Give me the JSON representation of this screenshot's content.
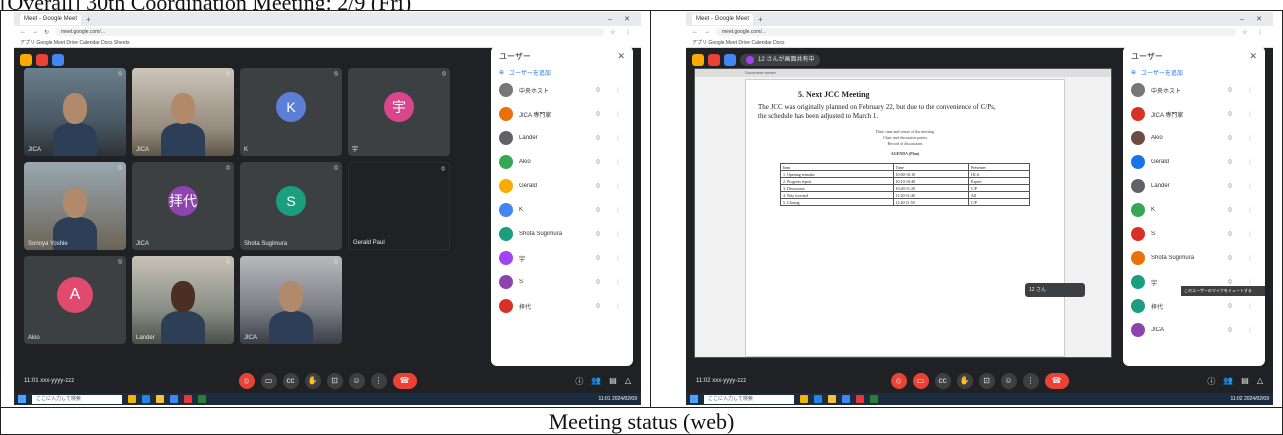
{
  "document": {
    "title": "[Overall] 30th Coordination Meeting: 2/9 (Fri)",
    "caption": "Meeting status (web)"
  },
  "left_screenshot": {
    "browser": {
      "tab_title": "Meet - Google Meet",
      "new_tab": "+",
      "window_controls": "– ✕",
      "url": "meet.google.com/...",
      "address_icons": "☆ ⋮",
      "bookmarks": "アプリ   Google   Meet   Drive   Calendar   Docs   Sheets"
    },
    "meet_icons": [
      "yellow-app-icon",
      "red-app-icon",
      "blue-app-icon"
    ],
    "tiles": [
      {
        "name": "JICA",
        "kind": "video",
        "video": "v1"
      },
      {
        "name": "JICA",
        "kind": "video",
        "video": "v2"
      },
      {
        "name": "K",
        "initial": "K",
        "color": "#5b7fd6"
      },
      {
        "name": "宇",
        "initial": "宇",
        "color": "#d9468c"
      },
      {
        "name": "Sonoya Yoshie",
        "kind": "video",
        "video": "v3"
      },
      {
        "name": "JICA",
        "initial": "拝代",
        "color": "#8e44ad"
      },
      {
        "name": "Shota Sugimura",
        "initial": "S",
        "color": "#1a9e7e"
      },
      {
        "name": "Gerald Paul",
        "kind": "dark"
      },
      {
        "name": "Akio",
        "initial": "A",
        "color": "#e04a6c"
      },
      {
        "name": "Lander",
        "kind": "video",
        "video": "v4",
        "face": "dark"
      },
      {
        "name": "JICA",
        "kind": "video",
        "video": "v5",
        "wide": true
      }
    ],
    "people_panel": {
      "title": "ユーザー",
      "add_people": "ユーザーを追加",
      "participants": [
        {
          "name": "中央ホスト",
          "color": "#777777"
        },
        {
          "name": "JICA 専門家",
          "color": "#e8710a"
        },
        {
          "name": "Lander",
          "color": "#5f6368"
        },
        {
          "name": "Akio",
          "color": "#34a853"
        },
        {
          "name": "Gerald",
          "color": "#f9ab00"
        },
        {
          "name": "K",
          "color": "#4285f4"
        },
        {
          "name": "Shota Sugimura",
          "color": "#1a9e7e"
        },
        {
          "name": "宇",
          "color": "#a142f4"
        },
        {
          "name": "S",
          "color": "#8e44ad"
        },
        {
          "name": "拝代",
          "color": "#d93025"
        }
      ]
    },
    "bottom": {
      "meeting_name": "11:01  xxx-yyyy-zzz",
      "controls": [
        "mic",
        "camera",
        "captions",
        "raise-hand",
        "present",
        "emoji",
        "more",
        "leave"
      ],
      "right_controls": [
        "info",
        "people",
        "chat",
        "activities"
      ]
    },
    "taskbar": {
      "search_placeholder": "ここに入力して検索",
      "clock": "11:01\n2024/02/09"
    }
  },
  "right_screenshot": {
    "browser": {
      "tab_title": "Meet - Google Meet",
      "url": "meet.google.com/...",
      "bookmarks": "アプリ   Google   Meet   Drive   Calendar   Docs"
    },
    "presenter_chip": "12 さんが画面共有中",
    "slide": {
      "toolbar_text": "Document viewer",
      "heading": "5.  Next JCC Meeting",
      "line1": "The JCC was originally planned on February 22, but due to the convenience of C/Ps,",
      "line2": "the schedule has been adjusted to March 1.",
      "center_lines": [
        "Date, time and venue of the meeting",
        "Chair and discussion points",
        "Record of discussions"
      ],
      "table_title": "AGENDA (Plan)",
      "table_rows": [
        [
          "Item",
          "Time",
          "Presenter"
        ],
        [
          "1. Opening remarks",
          "10:00-10:10",
          "JICA"
        ],
        [
          "2. Progress report",
          "10:10-10:40",
          "Expert"
        ],
        [
          "3. Discussion",
          "10:40-11:20",
          "C/P"
        ],
        [
          "4. Way forward",
          "11:20-11:40",
          "All"
        ],
        [
          "5. Closing",
          "11:40-11:50",
          "C/P"
        ]
      ]
    },
    "pip_label": "12 さん",
    "tooltip": "このユーザーのマイクをミュートする",
    "people_panel": {
      "title": "ユーザー",
      "add_people": "ユーザーを追加",
      "participants": [
        {
          "name": "中央ホスト",
          "color": "#777777"
        },
        {
          "name": "JICA 専門家",
          "color": "#d93025"
        },
        {
          "name": "Akio",
          "color": "#6d4c41"
        },
        {
          "name": "Gerald",
          "color": "#1a73e8"
        },
        {
          "name": "Lander",
          "color": "#5f6368"
        },
        {
          "name": "K",
          "color": "#34a853"
        },
        {
          "name": "S",
          "color": "#d93025"
        },
        {
          "name": "Shota Sugimura",
          "color": "#e8710a"
        },
        {
          "name": "宇",
          "color": "#1a9e7e"
        },
        {
          "name": "拝代",
          "color": "#1a9e7e"
        },
        {
          "name": "JICA",
          "color": "#8e44ad"
        }
      ]
    },
    "bottom": {
      "meeting_name": "11:02  xxx-yyyy-zzz"
    },
    "taskbar": {
      "search_placeholder": "ここに入力して検索",
      "clock": "11:02\n2024/02/09"
    }
  }
}
